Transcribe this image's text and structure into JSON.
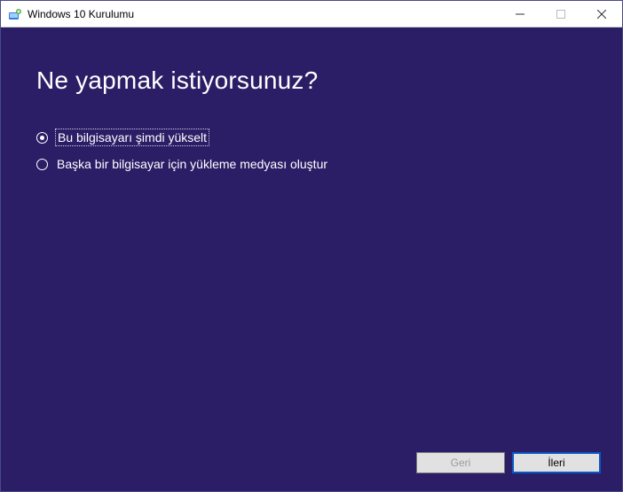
{
  "window": {
    "title": "Windows 10 Kurulumu"
  },
  "content": {
    "heading": "Ne yapmak istiyorsunuz?",
    "options": [
      {
        "label": "Bu bilgisayarı şimdi yükselt",
        "selected": true
      },
      {
        "label": "Başka bir bilgisayar için yükleme medyası oluştur",
        "selected": false
      }
    ]
  },
  "footer": {
    "back_label": "Geri",
    "next_label": "İleri"
  }
}
